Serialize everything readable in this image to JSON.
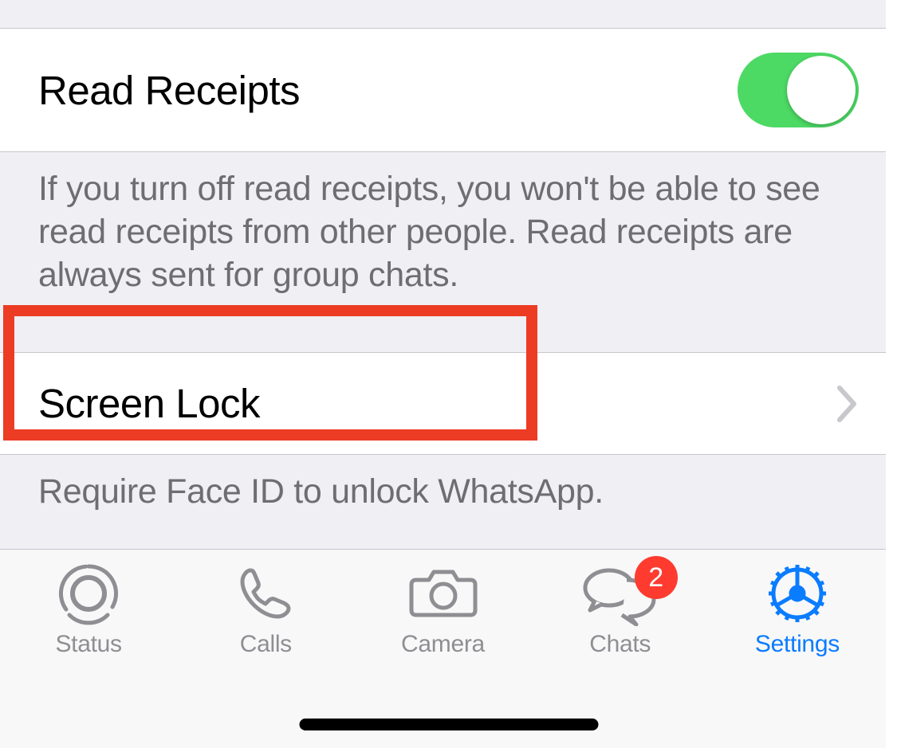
{
  "settings": {
    "read_receipts": {
      "label": "Read Receipts",
      "enabled": true,
      "footer": "If you turn off read receipts, you won't be able to see read receipts from other people. Read receipts are always sent for group chats."
    },
    "screen_lock": {
      "label": "Screen Lock",
      "footer": "Require Face ID to unlock WhatsApp."
    }
  },
  "tabs": {
    "status": {
      "label": "Status"
    },
    "calls": {
      "label": "Calls"
    },
    "camera": {
      "label": "Camera"
    },
    "chats": {
      "label": "Chats",
      "badge": "2"
    },
    "settings": {
      "label": "Settings"
    }
  },
  "colors": {
    "accent": "#0a7cff",
    "toggle_on": "#4cd964",
    "badge": "#ff3b30",
    "highlight": "#ec3c24"
  }
}
